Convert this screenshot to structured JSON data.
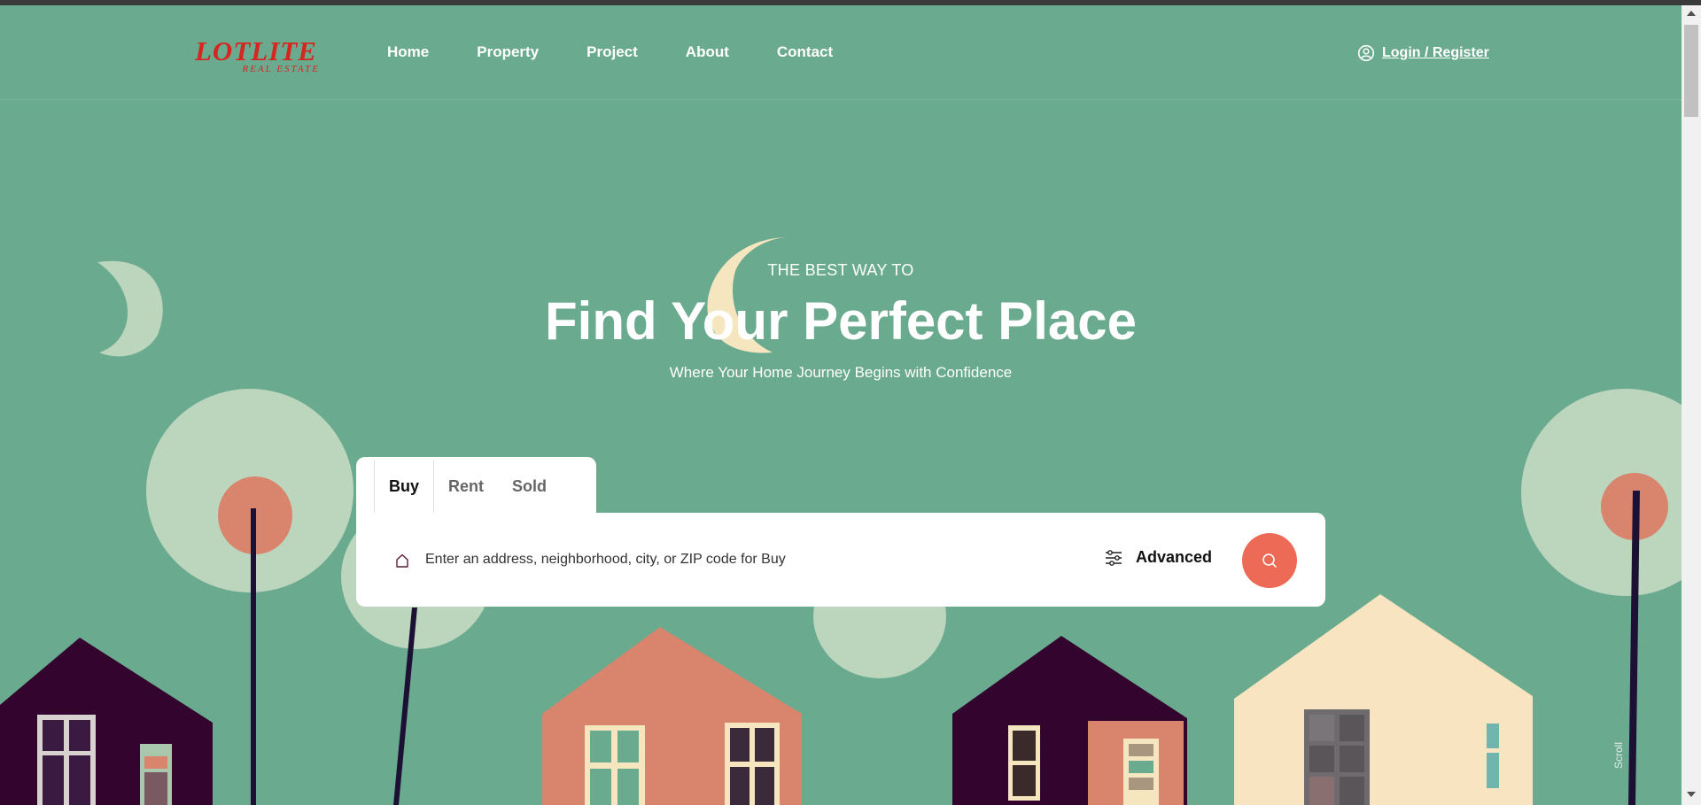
{
  "brand": {
    "name": "LOTLITE",
    "tagline": "REAL ESTATE",
    "color": "#d6261f"
  },
  "nav": {
    "items": [
      {
        "label": "Home"
      },
      {
        "label": "Property"
      },
      {
        "label": "Project"
      },
      {
        "label": "About"
      },
      {
        "label": "Contact"
      }
    ],
    "login_label": "Login / Register",
    "login_icon": "user-circle-icon"
  },
  "hero": {
    "eyebrow": "THE BEST WAY TO",
    "title": "Find Your Perfect Place",
    "subtitle": "Where Your Home Journey Begins with Confidence"
  },
  "search": {
    "tabs": [
      {
        "label": "Buy",
        "active": true
      },
      {
        "label": "Rent",
        "active": false
      },
      {
        "label": "Sold",
        "active": false
      }
    ],
    "input_icon": "home-icon",
    "placeholder": "Enter an address, neighborhood, city, or ZIP code for Buy",
    "advanced_label": "Advanced",
    "advanced_icon": "sliders-icon",
    "search_icon": "search-icon"
  },
  "scroll_label": "Scroll",
  "colors": {
    "background": "#6aaa8f",
    "accent": "#ec6a56",
    "tree_light": "#bcd5bd",
    "house_dark": "#33042e",
    "house_peach": "#d9846c",
    "house_cream": "#f8e4c0"
  }
}
